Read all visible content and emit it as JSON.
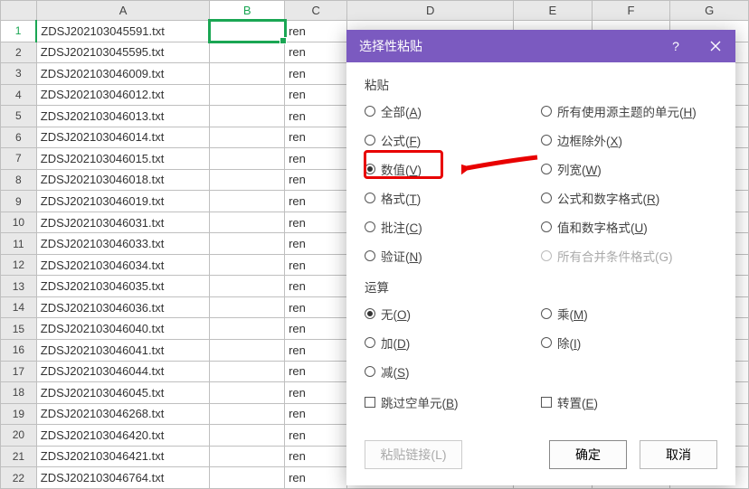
{
  "columns": [
    "A",
    "B",
    "C",
    "D",
    "E",
    "F",
    "G"
  ],
  "rowNumbers": [
    1,
    2,
    3,
    4,
    5,
    6,
    7,
    8,
    9,
    10,
    11,
    12,
    13,
    14,
    15,
    16,
    17,
    18,
    19,
    20,
    21,
    22
  ],
  "activeCol": "B",
  "activeRow": 1,
  "cells": {
    "A": [
      "ZDSJ202103045591.txt",
      "ZDSJ202103045595.txt",
      "ZDSJ202103046009.txt",
      "ZDSJ202103046012.txt",
      "ZDSJ202103046013.txt",
      "ZDSJ202103046014.txt",
      "ZDSJ202103046015.txt",
      "ZDSJ202103046018.txt",
      "ZDSJ202103046019.txt",
      "ZDSJ202103046031.txt",
      "ZDSJ202103046033.txt",
      "ZDSJ202103046034.txt",
      "ZDSJ202103046035.txt",
      "ZDSJ202103046036.txt",
      "ZDSJ202103046040.txt",
      "ZDSJ202103046041.txt",
      "ZDSJ202103046044.txt",
      "ZDSJ202103046045.txt",
      "ZDSJ202103046268.txt",
      "ZDSJ202103046420.txt",
      "ZDSJ202103046421.txt",
      "ZDSJ202103046764.txt"
    ],
    "C": [
      "ren",
      "ren",
      "ren",
      "ren",
      "ren",
      "ren",
      "ren",
      "ren",
      "ren",
      "ren",
      "ren",
      "ren",
      "ren",
      "ren",
      "ren",
      "ren",
      "ren",
      "ren",
      "ren",
      "ren",
      "ren",
      "ren"
    ]
  },
  "dialog": {
    "title": "选择性粘贴",
    "helpIcon": "?",
    "closeIcon": "×",
    "pasteGroup": "粘贴",
    "opts": {
      "all": {
        "t": "全部(",
        "u": "A",
        "e": ")"
      },
      "formulas": {
        "t": "公式(",
        "u": "F",
        "e": ")"
      },
      "values": {
        "t": "数值(",
        "u": "V",
        "e": ")"
      },
      "formats": {
        "t": "格式(",
        "u": "T",
        "e": ")"
      },
      "comments": {
        "t": "批注(",
        "u": "C",
        "e": ")"
      },
      "validation": {
        "t": "验证(",
        "u": "N",
        "e": ")"
      },
      "srcTheme": {
        "t": "所有使用源主题的单元(",
        "u": "H",
        "e": ")"
      },
      "exBorders": {
        "t": "边框除外(",
        "u": "X",
        "e": ")"
      },
      "colWidths": {
        "t": "列宽(",
        "u": "W",
        "e": ")"
      },
      "formulasNum": {
        "t": "公式和数字格式(",
        "u": "R",
        "e": ")"
      },
      "valuesNum": {
        "t": "值和数字格式(",
        "u": "U",
        "e": ")"
      },
      "mergeCond": {
        "t": "所有合并条件格式(G)",
        "u": "",
        "e": ""
      }
    },
    "opGroup": "运算",
    "ops": {
      "none": {
        "t": "无(",
        "u": "O",
        "e": ")"
      },
      "add": {
        "t": "加(",
        "u": "D",
        "e": ")"
      },
      "sub": {
        "t": "减(",
        "u": "S",
        "e": ")"
      },
      "mul": {
        "t": "乘(",
        "u": "M",
        "e": ")"
      },
      "div": {
        "t": "除(",
        "u": "I",
        "e": ")"
      }
    },
    "skipBlanks": {
      "t": "跳过空单元(",
      "u": "B",
      "e": ")"
    },
    "transpose": {
      "t": "转置(",
      "u": "E",
      "e": ")"
    },
    "pasteLink": "粘贴链接(L)",
    "ok": "确定",
    "cancel": "取消"
  }
}
